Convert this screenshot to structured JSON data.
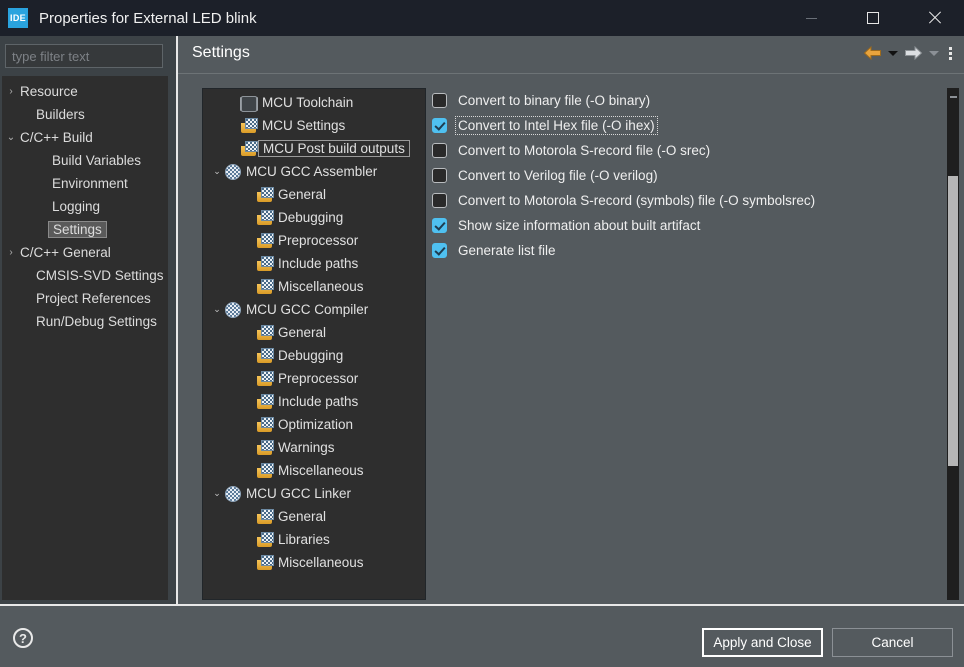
{
  "window": {
    "title": "Properties for External LED blink",
    "app_icon_text": "IDE",
    "controls": {
      "minimize": "minimize-button",
      "maximize": "maximize-button",
      "close": "close-button"
    }
  },
  "sidebar": {
    "filter_placeholder": "type filter text",
    "filter_value": "",
    "items": [
      {
        "label": "Resource",
        "indent": 0,
        "arrow": "›",
        "selected": false
      },
      {
        "label": "Builders",
        "indent": 1,
        "arrow": "",
        "selected": false
      },
      {
        "label": "C/C++ Build",
        "indent": 0,
        "arrow": "⌄",
        "selected": false
      },
      {
        "label": "Build Variables",
        "indent": 2,
        "arrow": "",
        "selected": false
      },
      {
        "label": "Environment",
        "indent": 2,
        "arrow": "",
        "selected": false
      },
      {
        "label": "Logging",
        "indent": 2,
        "arrow": "",
        "selected": false
      },
      {
        "label": "Settings",
        "indent": 2,
        "arrow": "",
        "selected": true
      },
      {
        "label": "C/C++ General",
        "indent": 0,
        "arrow": "›",
        "selected": false
      },
      {
        "label": "CMSIS-SVD Settings",
        "indent": 1,
        "arrow": "",
        "selected": false
      },
      {
        "label": "Project References",
        "indent": 1,
        "arrow": "",
        "selected": false
      },
      {
        "label": "Run/Debug Settings",
        "indent": 1,
        "arrow": "",
        "selected": false
      }
    ]
  },
  "header": {
    "title": "Settings",
    "back_icon": "back-arrow-icon",
    "back_menu_icon": "chevron-down-icon",
    "forward_icon": "forward-arrow-icon",
    "forward_menu_icon": "chevron-down-icon-disabled",
    "menu_icon": "kebab-menu-icon"
  },
  "tree": {
    "nodes": [
      {
        "label": "MCU Toolchain",
        "indent": 1,
        "arrow": "",
        "icon": "chip-icon",
        "focused": false
      },
      {
        "label": "MCU Settings",
        "indent": 1,
        "arrow": "",
        "icon": "folder-icon",
        "focused": false
      },
      {
        "label": "MCU Post build outputs",
        "indent": 1,
        "arrow": "",
        "icon": "folder-icon",
        "focused": true
      },
      {
        "label": "MCU GCC Assembler",
        "indent": 0,
        "arrow": "⌄",
        "icon": "gear-icon",
        "focused": false
      },
      {
        "label": "General",
        "indent": 2,
        "arrow": "",
        "icon": "folder-icon",
        "focused": false
      },
      {
        "label": "Debugging",
        "indent": 2,
        "arrow": "",
        "icon": "folder-icon",
        "focused": false
      },
      {
        "label": "Preprocessor",
        "indent": 2,
        "arrow": "",
        "icon": "folder-icon",
        "focused": false
      },
      {
        "label": "Include paths",
        "indent": 2,
        "arrow": "",
        "icon": "folder-icon",
        "focused": false
      },
      {
        "label": "Miscellaneous",
        "indent": 2,
        "arrow": "",
        "icon": "folder-icon",
        "focused": false
      },
      {
        "label": "MCU GCC Compiler",
        "indent": 0,
        "arrow": "⌄",
        "icon": "gear-icon",
        "focused": false
      },
      {
        "label": "General",
        "indent": 2,
        "arrow": "",
        "icon": "folder-icon",
        "focused": false
      },
      {
        "label": "Debugging",
        "indent": 2,
        "arrow": "",
        "icon": "folder-icon",
        "focused": false
      },
      {
        "label": "Preprocessor",
        "indent": 2,
        "arrow": "",
        "icon": "folder-icon",
        "focused": false
      },
      {
        "label": "Include paths",
        "indent": 2,
        "arrow": "",
        "icon": "folder-icon",
        "focused": false
      },
      {
        "label": "Optimization",
        "indent": 2,
        "arrow": "",
        "icon": "folder-icon",
        "focused": false
      },
      {
        "label": "Warnings",
        "indent": 2,
        "arrow": "",
        "icon": "folder-icon",
        "focused": false
      },
      {
        "label": "Miscellaneous",
        "indent": 2,
        "arrow": "",
        "icon": "folder-icon",
        "focused": false
      },
      {
        "label": "MCU GCC Linker",
        "indent": 0,
        "arrow": "⌄",
        "icon": "gear-icon",
        "focused": false
      },
      {
        "label": "General",
        "indent": 2,
        "arrow": "",
        "icon": "folder-icon",
        "focused": false
      },
      {
        "label": "Libraries",
        "indent": 2,
        "arrow": "",
        "icon": "folder-icon",
        "focused": false
      },
      {
        "label": "Miscellaneous",
        "indent": 2,
        "arrow": "",
        "icon": "folder-icon",
        "focused": false
      }
    ]
  },
  "options": [
    {
      "label": "Convert to binary file (-O binary)",
      "checked": false,
      "focused": false
    },
    {
      "label": "Convert to Intel Hex file (-O ihex)",
      "checked": true,
      "focused": true
    },
    {
      "label": "Convert to Motorola S-record file (-O srec)",
      "checked": false,
      "focused": false
    },
    {
      "label": "Convert to Verilog file (-O verilog)",
      "checked": false,
      "focused": false
    },
    {
      "label": "Convert to Motorola S-record (symbols) file (-O symbolsrec)",
      "checked": false,
      "focused": false
    },
    {
      "label": "Show size information about built artifact",
      "checked": true,
      "focused": false
    },
    {
      "label": "Generate list file",
      "checked": true,
      "focused": false
    }
  ],
  "footer": {
    "help_label": "?",
    "apply_label": "Apply and Close",
    "cancel_label": "Cancel"
  },
  "colors": {
    "titlebar": "#1c2029",
    "content_bg": "#545a5e",
    "tree_bg": "#2e2e2e",
    "accent_checkbox": "#4fc0f0",
    "back_arrow": "#e8a33d",
    "forward_arrow": "#d8dce0",
    "text": "#efefef"
  }
}
